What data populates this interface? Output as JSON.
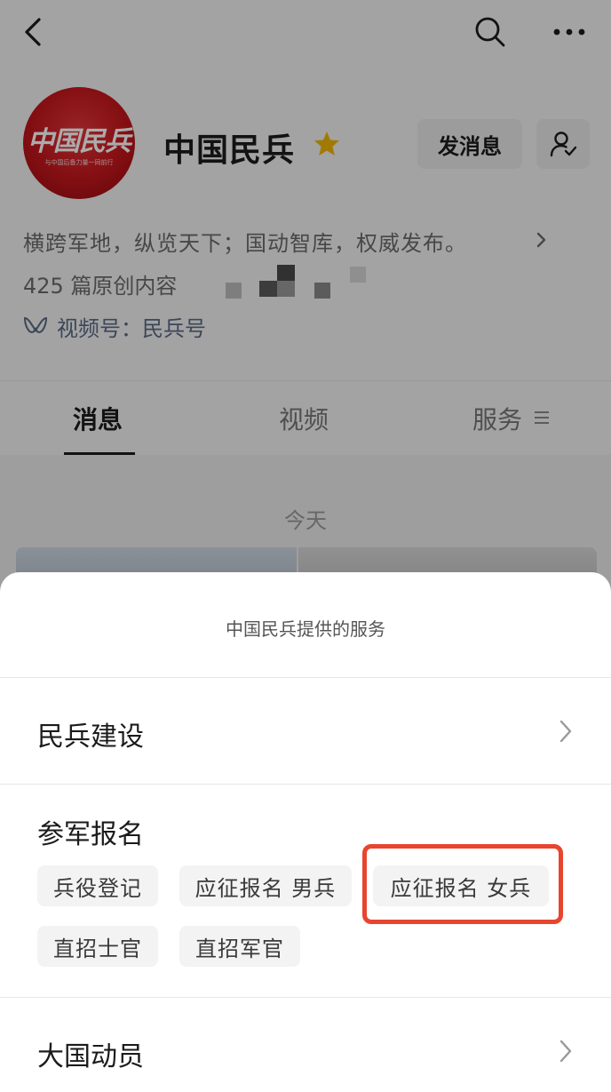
{
  "account": {
    "name": "中国民兵",
    "logo_text": "中国民兵",
    "logo_sub": "与中国后备力量一同前行",
    "message_button": "发消息",
    "description": "横跨军地，纵览天下；国动智库，权威发布。",
    "original_count": "425 篇原创内容",
    "channel": "视频号：民兵号"
  },
  "tabs": [
    {
      "label": "消息"
    },
    {
      "label": "视频"
    },
    {
      "label": "服务"
    }
  ],
  "feed": {
    "date_label": "今天"
  },
  "sheet": {
    "title": "中国民兵提供的服务",
    "sections": [
      {
        "title": "民兵建设"
      },
      {
        "title": "参军报名",
        "chips": [
          "兵役登记",
          "应征报名 男兵",
          "应征报名 女兵",
          "直招士官",
          "直招军官"
        ]
      },
      {
        "title": "大国动员"
      }
    ]
  },
  "colors": {
    "avatar_red": "#c4161c",
    "star": "#f2b705",
    "highlight": "#e8452f",
    "channel_text": "#5a6a84"
  },
  "icons": [
    "back-icon",
    "search-icon",
    "more-icon",
    "star-icon",
    "follow-icon",
    "chevron-right-icon",
    "channel-icon",
    "menu-lines-icon"
  ]
}
